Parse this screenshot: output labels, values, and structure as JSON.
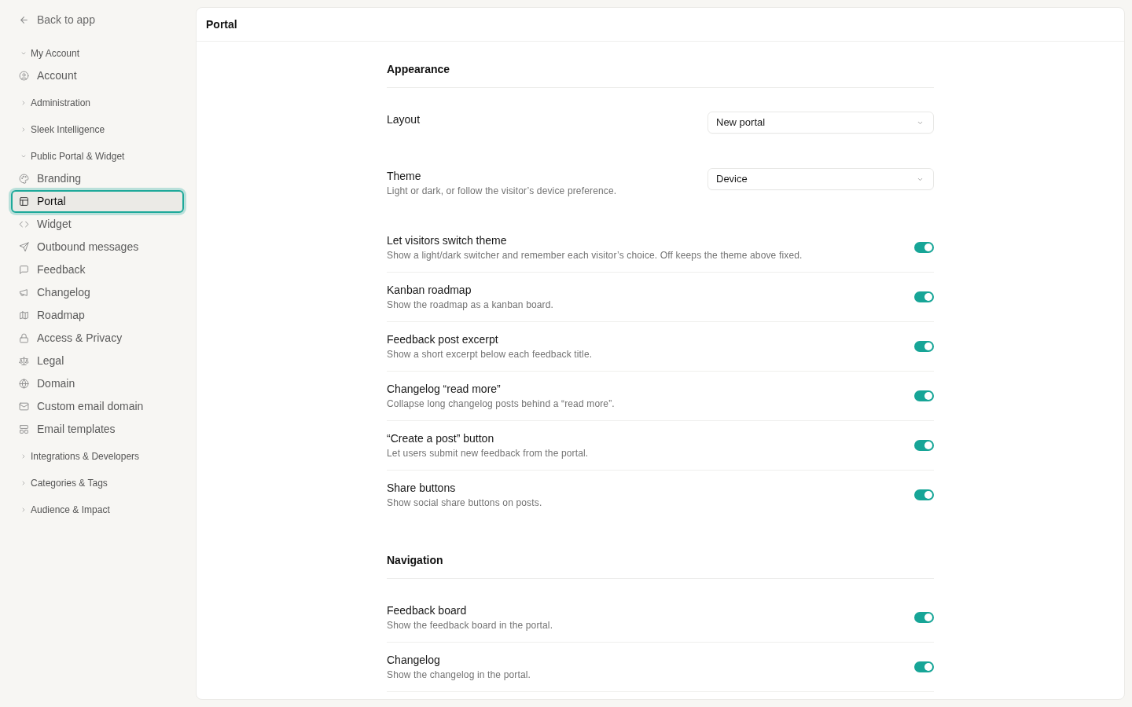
{
  "sidebar": {
    "back_link": {
      "label": "Back to app"
    },
    "groups": [
      {
        "label": "My Account",
        "expanded": true,
        "items": [
          {
            "label": "Account",
            "selected": false
          }
        ]
      },
      {
        "label": "Administration",
        "expanded": false
      },
      {
        "label": "Sleek Intelligence",
        "expanded": false
      },
      {
        "label": "Public Portal & Widget",
        "expanded": true,
        "items": [
          {
            "label": "Branding",
            "selected": false
          },
          {
            "label": "Portal",
            "selected": true
          },
          {
            "label": "Widget",
            "selected": false
          },
          {
            "label": "Outbound messages",
            "selected": false
          },
          {
            "label": "Feedback",
            "selected": false
          },
          {
            "label": "Changelog",
            "selected": false
          },
          {
            "label": "Roadmap",
            "selected": false
          },
          {
            "label": "Access & Privacy",
            "selected": false
          },
          {
            "label": "Legal",
            "selected": false
          },
          {
            "label": "Domain",
            "selected": false
          },
          {
            "label": "Custom email domain",
            "selected": false
          },
          {
            "label": "Email templates",
            "selected": false
          }
        ]
      },
      {
        "label": "Integrations & Developers",
        "expanded": false
      },
      {
        "label": "Categories & Tags",
        "expanded": false
      },
      {
        "label": "Audience & Impact",
        "expanded": false
      }
    ]
  },
  "panel": {
    "title": "Portal",
    "sections": [
      {
        "title": "Appearance",
        "settings": [
          {
            "kind": "select",
            "label": "Layout",
            "value": "New portal"
          },
          {
            "kind": "select",
            "label": "Theme",
            "description": "Light or dark, or follow the visitor’s device preference.",
            "value": "Device"
          },
          {
            "kind": "toggle",
            "label": "Let visitors switch theme",
            "description": "Show a light/dark switcher and remember each visitor’s choice. Off keeps the theme above fixed.",
            "on": true
          },
          {
            "kind": "toggle",
            "label": "Kanban roadmap",
            "description": "Show the roadmap as a kanban board.",
            "on": true
          },
          {
            "kind": "toggle",
            "label": "Feedback post excerpt",
            "description": "Show a short excerpt below each feedback title.",
            "on": true
          },
          {
            "kind": "toggle",
            "label": "Changelog “read more”",
            "description": "Collapse long changelog posts behind a “read more”.",
            "on": true
          },
          {
            "kind": "toggle",
            "label": "“Create a post” button",
            "description": "Let users submit new feedback from the portal.",
            "on": true
          },
          {
            "kind": "toggle",
            "label": "Share buttons",
            "description": "Show social share buttons on posts.",
            "on": true
          }
        ]
      },
      {
        "title": "Navigation",
        "settings": [
          {
            "kind": "toggle",
            "label": "Feedback board",
            "description": "Show the feedback board in the portal.",
            "on": true
          },
          {
            "kind": "toggle",
            "label": "Changelog",
            "description": "Show the changelog in the portal.",
            "on": true
          }
        ]
      }
    ]
  }
}
